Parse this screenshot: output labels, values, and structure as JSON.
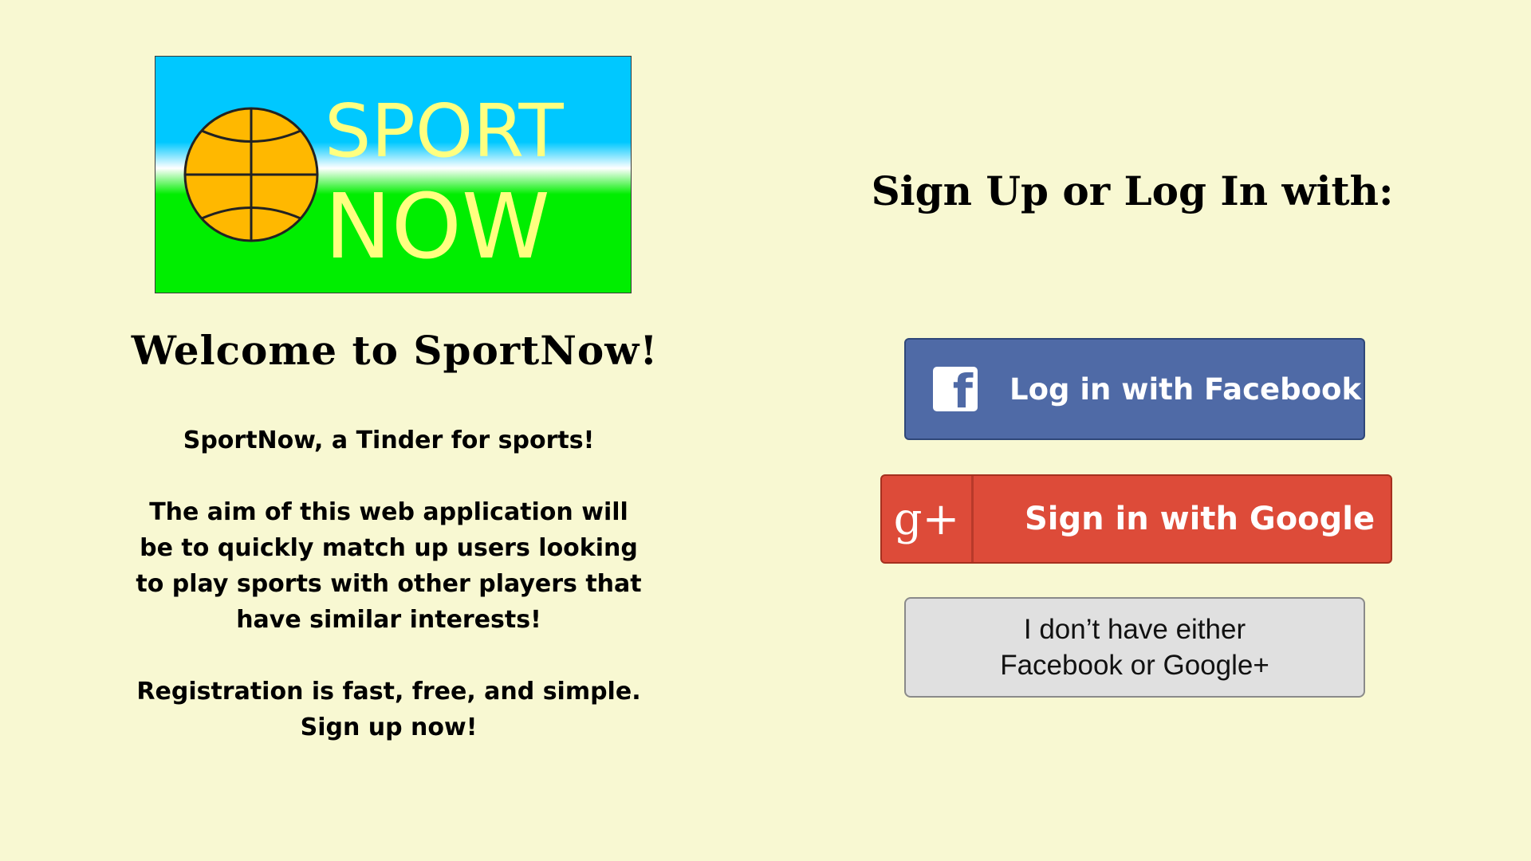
{
  "logo": {
    "word1": "SPORT",
    "word2": "NOW",
    "colors": {
      "sky": "#00c8ff",
      "grass": "#00ee00",
      "ball": "#ffb800",
      "text": "#ffff80"
    }
  },
  "left": {
    "welcome": "Welcome to SportNow!",
    "tagline": "SportNow, a Tinder for sports!",
    "aim_lines": [
      "The aim of this web application will",
      "be to quickly match up users looking",
      "to play sports with other players that",
      "have similar interests!"
    ],
    "registration_lines": [
      "Registration is fast, free, and simple.",
      "Sign up now!"
    ]
  },
  "right": {
    "heading": "Sign Up or Log In with:",
    "facebook_button": {
      "icon": "facebook-icon",
      "icon_glyph": "f",
      "label": "Log in with Facebook",
      "color": "#4f6aa6"
    },
    "google_button": {
      "icon": "google-plus-icon",
      "icon_glyph": "g+",
      "label": "Sign in with Google",
      "color": "#dd4b39"
    },
    "other_button": {
      "line1": "I don’t have either",
      "line2": "Facebook or Google+"
    }
  }
}
